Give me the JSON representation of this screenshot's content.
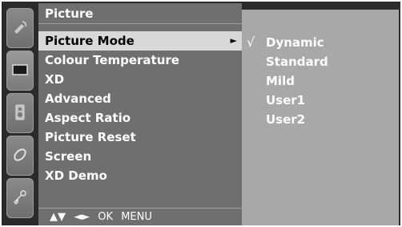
{
  "menu": {
    "title": "Picture",
    "items": [
      {
        "label": "Picture Mode",
        "selected": true,
        "has_submenu": true
      },
      {
        "label": "Colour Temperature"
      },
      {
        "label": "XD"
      },
      {
        "label": "Advanced"
      },
      {
        "label": "Aspect Ratio"
      },
      {
        "label": "Picture Reset"
      },
      {
        "label": "Screen"
      },
      {
        "label": "XD Demo"
      }
    ],
    "submenu_arrow": "►",
    "footer": {
      "updown": "▲▼",
      "leftright": "◄►",
      "ok": "OK",
      "menu": "MENU"
    }
  },
  "submenu": {
    "check": "√",
    "items": [
      {
        "label": "Dynamic",
        "checked": true
      },
      {
        "label": "Standard"
      },
      {
        "label": "Mild"
      },
      {
        "label": "User1"
      },
      {
        "label": "User2"
      }
    ]
  },
  "icons": [
    "satellite-icon",
    "screen-icon",
    "speaker-icon",
    "disc-icon",
    "key-icon"
  ],
  "colors": {
    "background": "#2b2b2b",
    "menu_panel": "#6f6f6f",
    "submenu_panel": "#a8a8a8",
    "highlight": "#d8d8d8",
    "text": "#ffffff"
  }
}
